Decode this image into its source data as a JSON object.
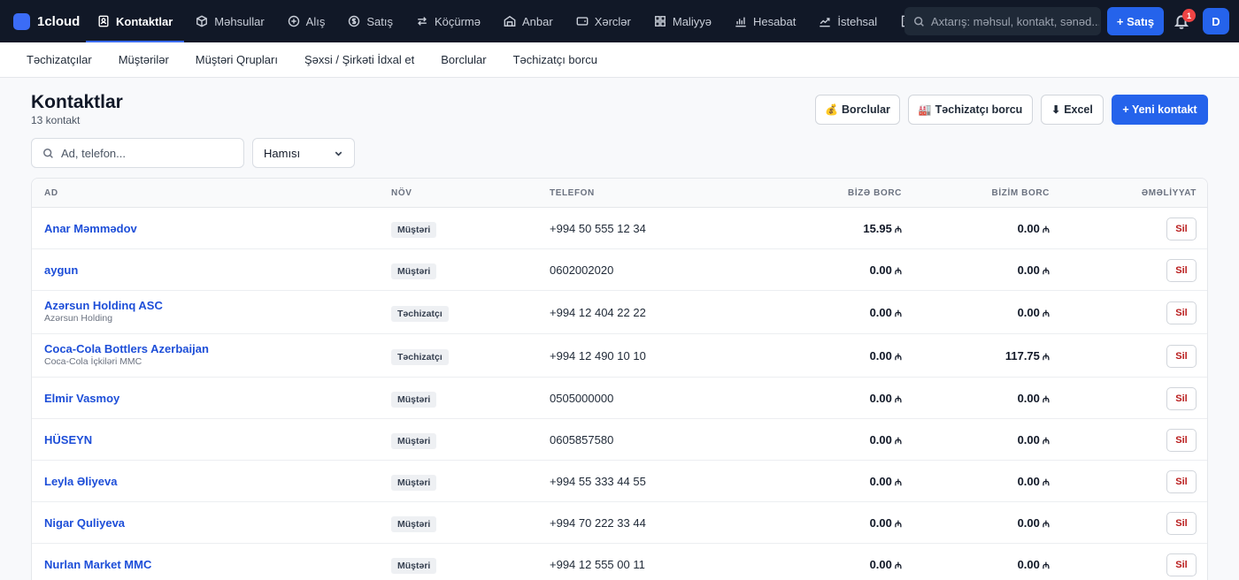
{
  "app": {
    "name": "1cloud",
    "brand_color": "#3b6cf6"
  },
  "nav": {
    "items": [
      {
        "label": "Kontaktlar",
        "icon": "contacts-icon",
        "active": true
      },
      {
        "label": "Məhsullar",
        "icon": "box-icon"
      },
      {
        "label": "Alış",
        "icon": "plus-circle-icon"
      },
      {
        "label": "Satış",
        "icon": "dollar-circle-icon"
      },
      {
        "label": "Köçürmə",
        "icon": "transfer-arrows-icon"
      },
      {
        "label": "Anbar",
        "icon": "warehouse-icon"
      },
      {
        "label": "Xərclər",
        "icon": "wallet-icon"
      },
      {
        "label": "Maliyyə",
        "icon": "grid-icon"
      },
      {
        "label": "Hesabat",
        "icon": "bar-chart-icon"
      },
      {
        "label": "İstehsal",
        "icon": "trend-chart-icon"
      },
      {
        "label": "",
        "icon": "building-icon"
      }
    ],
    "search_placeholder": "Axtarış: məhsul, kontakt, sənəd...",
    "sale_button": "+ Satış",
    "notification_count": "1",
    "avatar_initial": "D"
  },
  "subnav": {
    "items": [
      "Təchizatçılar",
      "Müştərilər",
      "Müştəri Qrupları",
      "Şəxsi / Şirkəti İdxal et",
      "Borclular",
      "Təchizatçı borcu"
    ]
  },
  "page": {
    "title": "Kontaktlar",
    "count": "13 kontakt",
    "buttons": {
      "debtors": "Borclular",
      "debtors_icon": "💰",
      "supplier_debt": "Təchizatçı borcu",
      "supplier_debt_icon": "🏭",
      "excel": "Excel",
      "excel_icon": "⬇",
      "new_contact": "+ Yeni kontakt"
    }
  },
  "filters": {
    "search_placeholder": "Ad, telefon...",
    "type_selected": "Hamısı"
  },
  "table": {
    "headers": {
      "name": "AD",
      "type": "NÖV",
      "phone": "TELEFON",
      "owed_to_us": "BİZƏ BORC",
      "our_debt": "BİZİM BORC",
      "actions": "ƏMƏLİYYAT"
    },
    "currency": "₼",
    "delete_label": "Sil",
    "rows": [
      {
        "name": "Anar Məmmədov",
        "sub": "",
        "type": "Müştəri",
        "phone": "+994 50 555 12 34",
        "owed_to_us": "15.95",
        "our_debt": "0.00"
      },
      {
        "name": "aygun",
        "sub": "",
        "type": "Müştəri",
        "phone": "0602002020",
        "owed_to_us": "0.00",
        "our_debt": "0.00"
      },
      {
        "name": "Azərsun Holdinq ASC",
        "sub": "Azərsun Holding",
        "type": "Təchizatçı",
        "phone": "+994 12 404 22 22",
        "owed_to_us": "0.00",
        "our_debt": "0.00"
      },
      {
        "name": "Coca-Cola Bottlers Azerbaijan",
        "sub": "Coca-Cola İçkiləri MMC",
        "type": "Təchizatçı",
        "phone": "+994 12 490 10 10",
        "owed_to_us": "0.00",
        "our_debt": "117.75"
      },
      {
        "name": "Elmir Vasmoy",
        "sub": "",
        "type": "Müştəri",
        "phone": "0505000000",
        "owed_to_us": "0.00",
        "our_debt": "0.00"
      },
      {
        "name": "HÜSEYN",
        "sub": "",
        "type": "Müştəri",
        "phone": "0605857580",
        "owed_to_us": "0.00",
        "our_debt": "0.00"
      },
      {
        "name": "Leyla Əliyeva",
        "sub": "",
        "type": "Müştəri",
        "phone": "+994 55 333 44 55",
        "owed_to_us": "0.00",
        "our_debt": "0.00"
      },
      {
        "name": "Nigar Quliyeva",
        "sub": "",
        "type": "Müştəri",
        "phone": "+994 70 222 33 44",
        "owed_to_us": "0.00",
        "our_debt": "0.00"
      },
      {
        "name": "Nurlan Market MMC",
        "sub": "",
        "type": "Müştəri",
        "phone": "+994 12 555 00 11",
        "owed_to_us": "0.00",
        "our_debt": "0.00"
      }
    ]
  }
}
